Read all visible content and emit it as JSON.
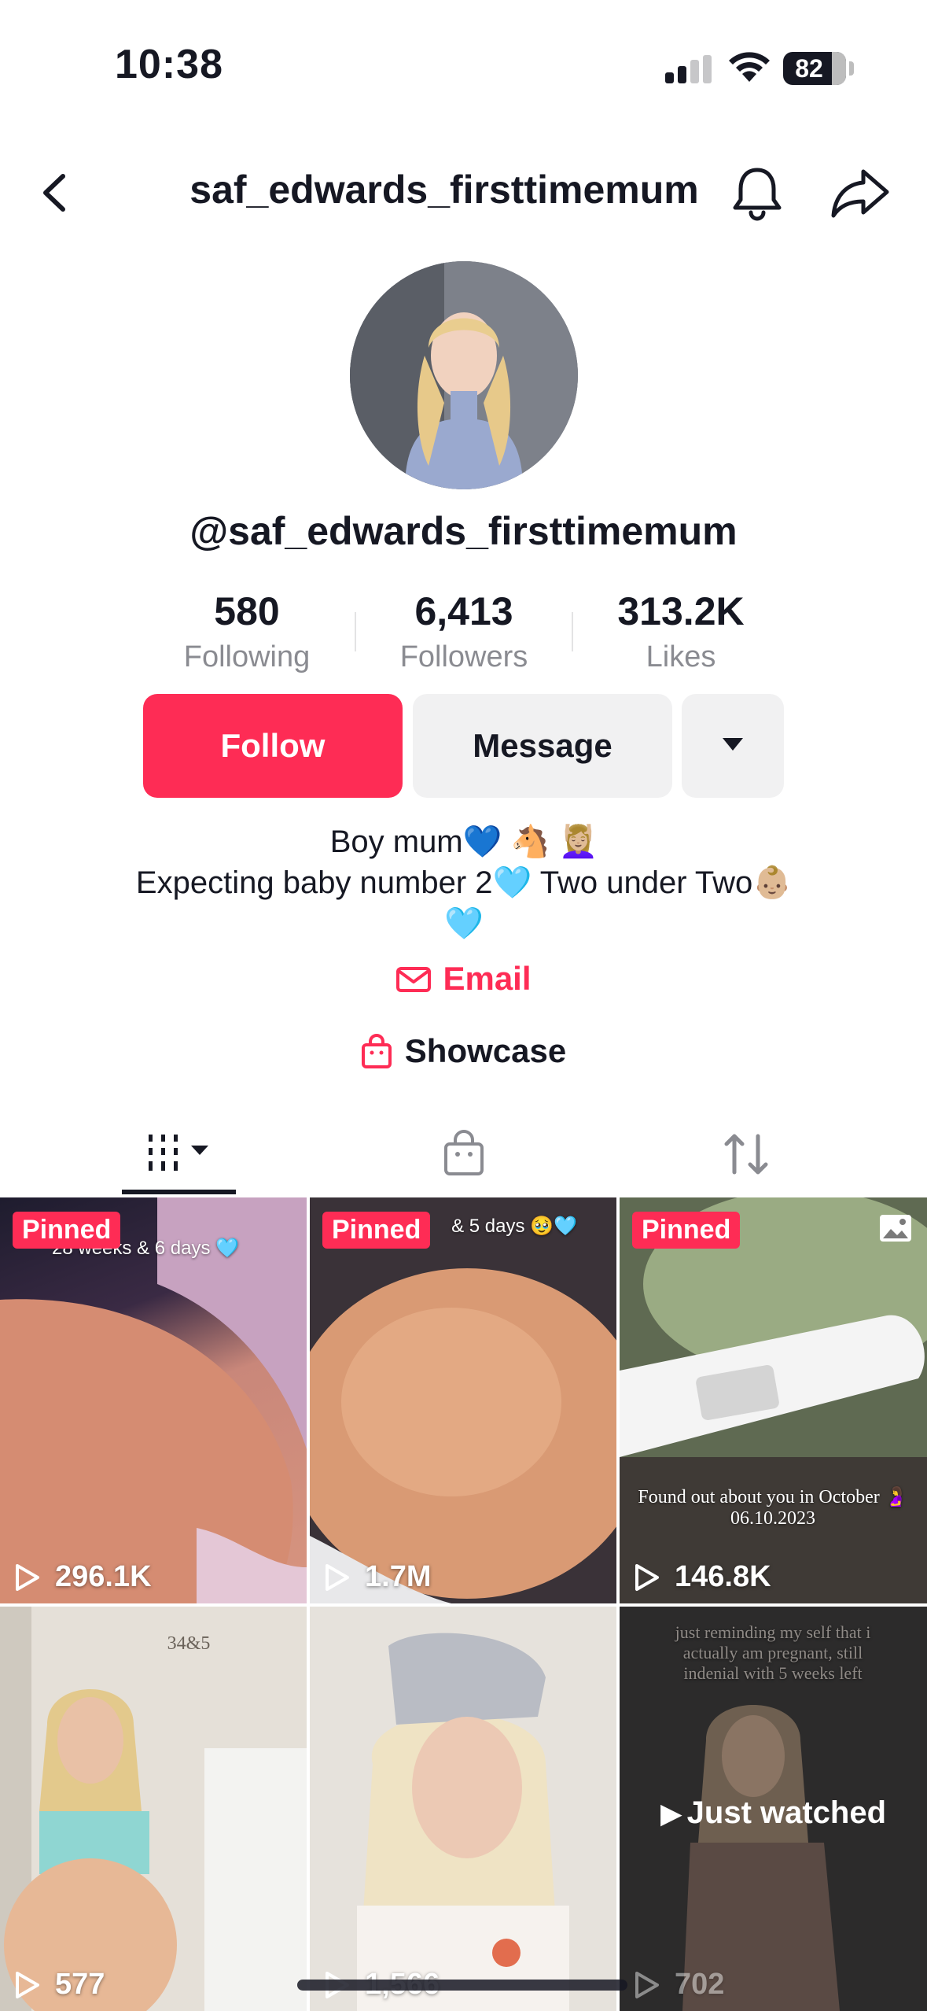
{
  "status_bar": {
    "time": "10:38",
    "battery": "82"
  },
  "nav": {
    "title": "saf_edwards_firsttimemum"
  },
  "profile": {
    "handle": "@saf_edwards_firsttimemum",
    "stats": [
      {
        "value": "580",
        "label": "Following"
      },
      {
        "value": "6,413",
        "label": "Followers"
      },
      {
        "value": "313.2K",
        "label": "Likes"
      }
    ],
    "follow_label": "Follow",
    "message_label": "Message",
    "bio_line1": "Boy mum💙 🐴 💆🏼‍♀️",
    "bio_line2": "Expecting baby number 2🩵 Two under Two👶🏼",
    "bio_line3": "🩵",
    "email_label": "Email",
    "showcase_label": "Showcase"
  },
  "tabs": [
    "videos-tab",
    "shop-tab",
    "reposts-tab"
  ],
  "videos": [
    {
      "pinned": "Pinned",
      "overlay": "28 weeks & 6 days 🩵",
      "views": "296.1K"
    },
    {
      "pinned": "Pinned",
      "overlay": "& 5 days 🥹🩵",
      "views": "1.7M"
    },
    {
      "pinned": "Pinned",
      "overlay": "Found out about you in October 🤰 06.10.2023",
      "views": "146.8K"
    },
    {
      "pinned": "",
      "overlay": "34&5",
      "views": "577"
    },
    {
      "pinned": "",
      "overlay": "",
      "views": "1,566"
    },
    {
      "pinned": "",
      "overlay": "just reminding my self that i actually am pregnant, still indenial with 5 weeks left",
      "views": "702",
      "just_watched": "Just watched"
    }
  ],
  "colors": {
    "accent": "#fe2c55",
    "text": "#161823",
    "muted": "#8a8b91",
    "button_gray": "#f1f1f2"
  }
}
